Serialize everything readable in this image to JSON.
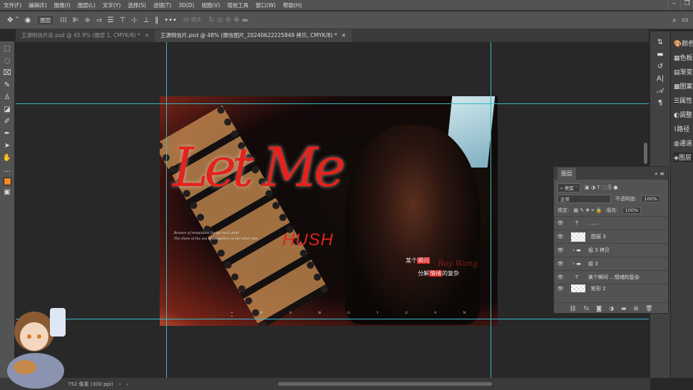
{
  "menu": [
    "文件(F)",
    "编辑(E)",
    "图像(I)",
    "图层(L)",
    "文字(Y)",
    "选择(S)",
    "滤镜(T)",
    "3D(D)",
    "视图(V)",
    "增效工具",
    "窗口(W)",
    "帮助(H)"
  ],
  "options": {
    "auto_select": "图层",
    "mode_3d": "3D 模式:"
  },
  "tabs": [
    {
      "label": "王源明信片反.psd @ 45.9% (图层 1, CMYK/8) *",
      "active": false
    },
    {
      "label": "王源明信片.psd @ 48% (微信图片_20240622225849 拷贝, CMYK/8) *",
      "active": true
    }
  ],
  "artwork": {
    "title": "Let Me",
    "subtitle": "HUSH",
    "eng1": "Beware of temptation Dodge each other",
    "eng2": "The shore of the sea of peopleNot on the other side",
    "cn1a": "某个",
    "cn1b": "瞬间",
    "cn2a": "分解",
    "cn2b": "情绪",
    "cn2c": "的复杂",
    "signature": "Roy Wang",
    "spell": "• W A N G Y U A N •"
  },
  "right_panels": [
    "颜色",
    "色板",
    "渐变",
    "图案",
    "属性",
    "调整",
    "路径",
    "通道",
    "图层"
  ],
  "layers_panel": {
    "tab": "图层",
    "filter": "类型",
    "blend": "正常",
    "opacity_label": "不透明度:",
    "opacity": "100%",
    "lock_label": "锁定:",
    "fill_label": "填充:",
    "fill": "100%",
    "layers": [
      {
        "type": "text",
        "name": ".          ...          ."
      },
      {
        "type": "pixel",
        "name": "图层 3"
      },
      {
        "type": "group",
        "name": "组 3 拷贝"
      },
      {
        "type": "group",
        "name": "组 3"
      },
      {
        "type": "text",
        "name": "某个瞬间 ...情绪的复杂"
      },
      {
        "type": "shape",
        "name": "矩形 2"
      }
    ]
  },
  "status": {
    "size": "752 像素 (300 ppi)"
  },
  "colors": {
    "guide": "#37b9c6",
    "accent_red": "#e3231c",
    "foreground": "#f08a24"
  }
}
